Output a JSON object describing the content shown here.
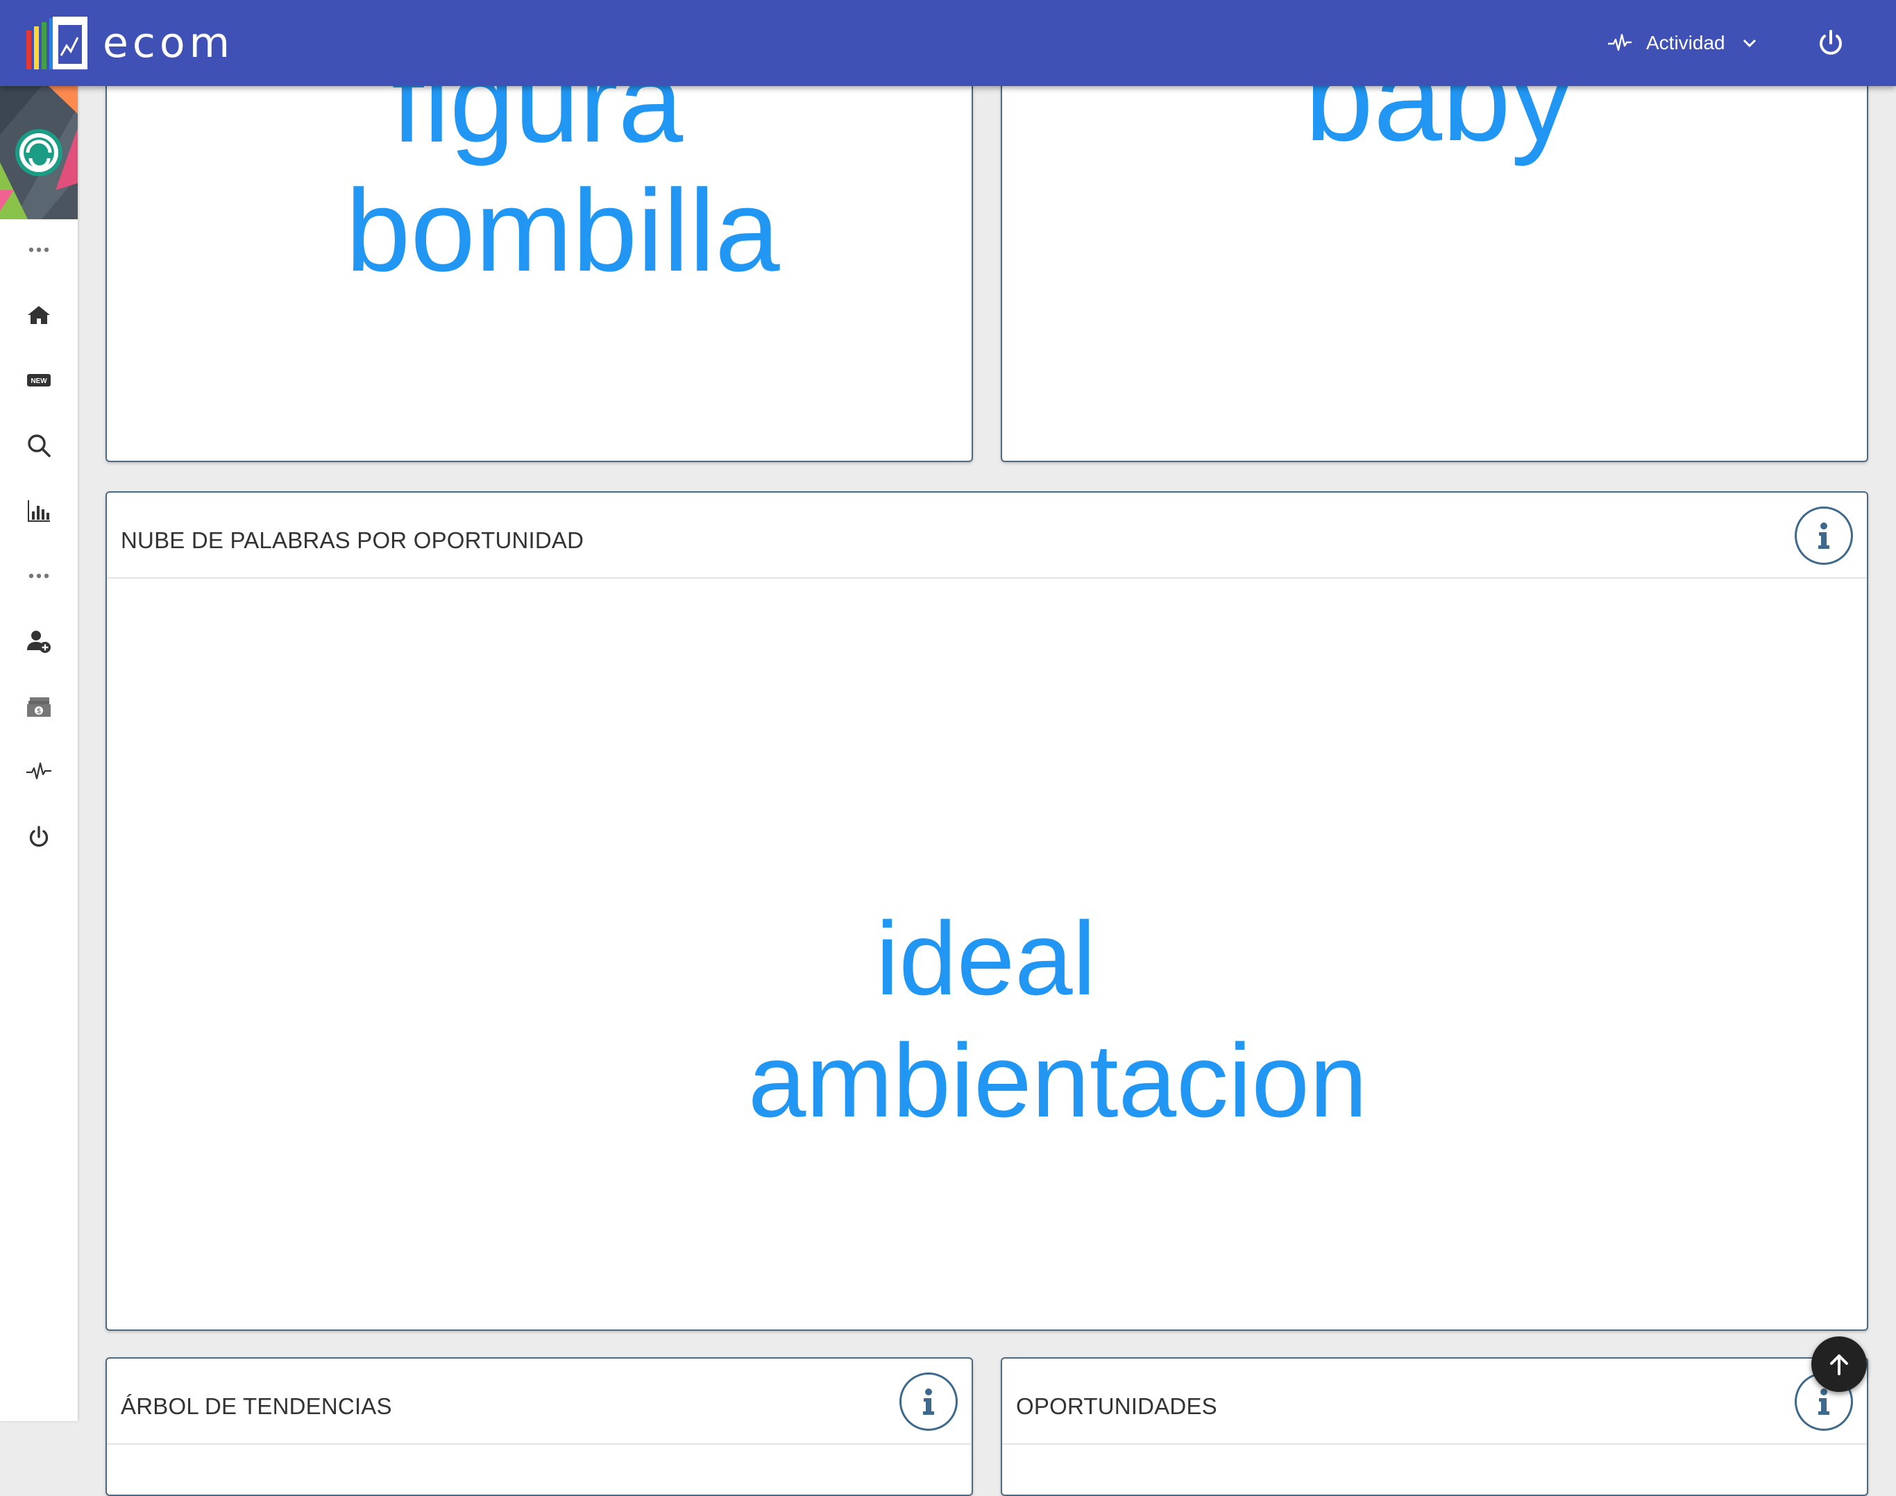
{
  "app": {
    "brand_name": "ecom",
    "brand_colors": [
      "#e53935",
      "#fdd835",
      "#43a047",
      "#1e88e5"
    ],
    "topbar_color": "#3f51b5"
  },
  "topbar": {
    "activity_label": "Actividad",
    "activity_icon": "pulse-icon",
    "dropdown_icon": "chevron-down-icon",
    "power_icon": "power-icon"
  },
  "sidebar": {
    "items": [
      {
        "icon": "more-dots-icon"
      },
      {
        "icon": "home-icon"
      },
      {
        "icon": "new-badge-icon",
        "label": "NEW"
      },
      {
        "icon": "search-icon"
      },
      {
        "icon": "bar-chart-icon"
      },
      {
        "icon": "more-dots-icon"
      },
      {
        "icon": "add-user-icon"
      },
      {
        "icon": "money-icon"
      },
      {
        "icon": "pulse-icon"
      },
      {
        "icon": "power-icon"
      }
    ]
  },
  "cards": {
    "top_left": {
      "words": [
        "figura",
        "bombilla"
      ]
    },
    "top_right": {
      "words": [
        "baby"
      ]
    },
    "word_cloud": {
      "title": "NUBE DE PALABRAS POR OPORTUNIDAD",
      "words": [
        "ideal",
        "ambientacion"
      ],
      "info_icon": "info-icon"
    },
    "trends": {
      "title": "ÁRBOL DE TENDENCIAS",
      "info_icon": "info-icon"
    },
    "opportunities": {
      "title": "OPORTUNIDADES",
      "info_icon": "info-icon"
    }
  },
  "word_color": "#2196f3",
  "fab": {
    "icon": "arrow-up-icon"
  }
}
